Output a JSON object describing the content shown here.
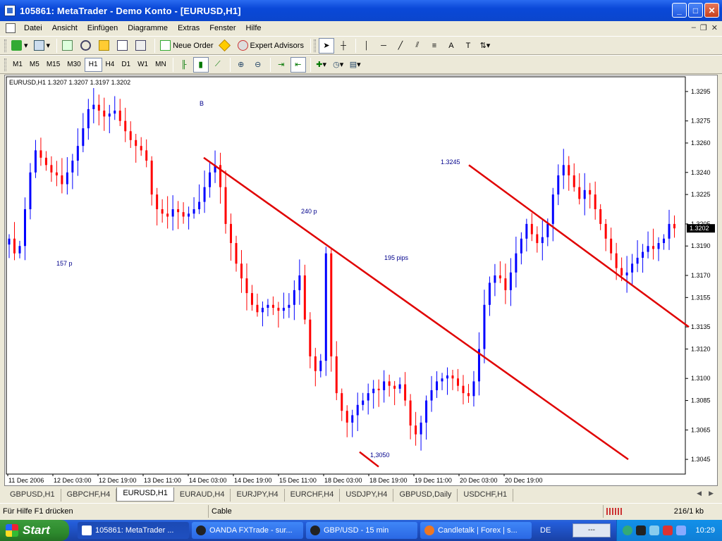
{
  "window": {
    "title": "105861: MetaTrader - Demo Konto - [EURUSD,H1]"
  },
  "menu": [
    "Datei",
    "Ansicht",
    "Einfügen",
    "Diagramme",
    "Extras",
    "Fenster",
    "Hilfe"
  ],
  "toolbar": {
    "new_order": "Neue Order",
    "expert_advisors": "Expert Advisors"
  },
  "timeframes": [
    "M1",
    "M5",
    "M15",
    "M30",
    "H1",
    "H4",
    "D1",
    "W1",
    "MN"
  ],
  "active_timeframe": "H1",
  "chart": {
    "header": "EURUSD,H1  1.3207 1.3207 1.3197 1.3202",
    "current_price": "1.3202",
    "annotations": [
      "B",
      "157 p",
      "240 p",
      "195 pips",
      "1.3245",
      "1,3050"
    ],
    "bull_color": "#0000ff",
    "bear_color": "#ff0000",
    "line_color": "#e00000"
  },
  "chart_data": {
    "type": "candlestick",
    "title": "EURUSD,H1",
    "y_ticks": [
      "1.3295",
      "1.3275",
      "1.3260",
      "1.3240",
      "1.3225",
      "1.3205",
      "1.3190",
      "1.3170",
      "1.3155",
      "1.3135",
      "1.3120",
      "1.3100",
      "1.3085",
      "1.3065",
      "1.3045"
    ],
    "x_ticks": [
      "11 Dec 2006",
      "12 Dec 03:00",
      "12 Dec 19:00",
      "13 Dec 11:00",
      "14 Dec 03:00",
      "14 Dec 19:00",
      "15 Dec 11:00",
      "18 Dec 03:00",
      "18 Dec 19:00",
      "19 Dec 11:00",
      "20 Dec 03:00",
      "20 Dec 19:00"
    ],
    "ylim": [
      1.3035,
      1.3305
    ],
    "close_path": [
      1.3195,
      1.3185,
      1.319,
      1.3215,
      1.324,
      1.3255,
      1.325,
      1.3245,
      1.324,
      1.3238,
      1.3232,
      1.324,
      1.3248,
      1.3258,
      1.327,
      1.3283,
      1.3286,
      1.3282,
      1.3278,
      1.328,
      1.3282,
      1.3275,
      1.3268,
      1.3262,
      1.3258,
      1.3255,
      1.3248,
      1.3225,
      1.3215,
      1.3212,
      1.321,
      1.3215,
      1.3213,
      1.321,
      1.3212,
      1.3215,
      1.322,
      1.323,
      1.324,
      1.3245,
      1.323,
      1.3205,
      1.3192,
      1.3178,
      1.3168,
      1.3158,
      1.315,
      1.3145,
      1.3148,
      1.315,
      1.3148,
      1.3146,
      1.3148,
      1.315,
      1.316,
      1.317,
      1.314,
      1.3115,
      1.3105,
      1.3112,
      1.3185,
      1.3115,
      1.309,
      1.3078,
      1.307,
      1.3075,
      1.3082,
      1.3085,
      1.309,
      1.3093,
      1.3092,
      1.3098,
      1.3095,
      1.3093,
      1.3096,
      1.3085,
      1.3068,
      1.3062,
      1.307,
      1.3085,
      1.3092,
      1.3098,
      1.31,
      1.3102,
      1.31,
      1.3095,
      1.309,
      1.3088,
      1.3098,
      1.312,
      1.315,
      1.3165,
      1.317,
      1.3168,
      1.316,
      1.3172,
      1.3185,
      1.3195,
      1.3205,
      1.3198,
      1.3192,
      1.3196,
      1.3205,
      1.3225,
      1.3238,
      1.3245,
      1.3238,
      1.323,
      1.3222,
      1.3228,
      1.3225,
      1.3215,
      1.3205,
      1.3195,
      1.3185,
      1.3175,
      1.317,
      1.3172,
      1.3178,
      1.3182,
      1.3186,
      1.319,
      1.3188,
      1.3192,
      1.3195,
      1.3205,
      1.3202
    ]
  },
  "tabs": [
    "GBPUSD,H1",
    "GBPCHF,H4",
    "EURUSD,H1",
    "EURAUD,H4",
    "EURJPY,H4",
    "EURCHF,H4",
    "USDJPY,H4",
    "GBPUSD,Daily",
    "USDCHF,H1"
  ],
  "active_tab": "EURUSD,H1",
  "status": {
    "help": "Für Hilfe F1 drücken",
    "profile": "Cable",
    "traffic": "216/1 kb"
  },
  "taskbar": {
    "start": "Start",
    "items": [
      "105861: MetaTrader ...",
      "OANDA FXTrade - sur...",
      "GBP/USD - 15 min",
      "Candletalk | Forex | s..."
    ],
    "lang": "DE",
    "ime": "---",
    "clock": "10:29"
  }
}
